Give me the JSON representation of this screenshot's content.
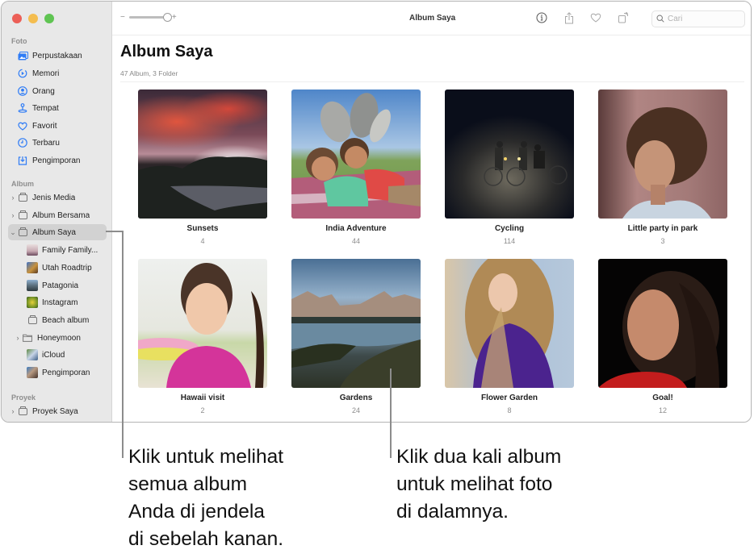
{
  "window": {
    "title": "Album Saya",
    "traffic_lights": [
      "close",
      "minimize",
      "zoom"
    ]
  },
  "toolbar": {
    "zoom_minus": "−",
    "zoom_plus": "+",
    "zoom_level": 1.0,
    "icons": [
      "info-icon",
      "share-icon",
      "heart-icon",
      "rotate-icon"
    ],
    "search_placeholder": "Cari",
    "search_value": ""
  },
  "sidebar": {
    "sections": [
      {
        "label": "Foto",
        "items": [
          {
            "label": "Perpustakaan",
            "icon": "photo-library-icon"
          },
          {
            "label": "Memori",
            "icon": "memories-icon"
          },
          {
            "label": "Orang",
            "icon": "people-icon"
          },
          {
            "label": "Tempat",
            "icon": "places-icon"
          },
          {
            "label": "Favorit",
            "icon": "heart-icon"
          },
          {
            "label": "Terbaru",
            "icon": "clock-icon"
          },
          {
            "label": "Pengimporan",
            "icon": "import-icon"
          }
        ]
      },
      {
        "label": "Album",
        "items": [
          {
            "label": "Jenis Media",
            "icon": "album-stack-icon",
            "expandable": true,
            "expanded": false
          },
          {
            "label": "Album Bersama",
            "icon": "shared-album-icon",
            "expandable": true,
            "expanded": false
          },
          {
            "label": "Album Saya",
            "icon": "album-stack-icon",
            "expandable": true,
            "expanded": true,
            "selected": true
          },
          {
            "label": "Family Family...",
            "icon": "album-thumbnail",
            "indent": 1
          },
          {
            "label": "Utah Roadtrip",
            "icon": "album-thumbnail",
            "indent": 1
          },
          {
            "label": "Patagonia",
            "icon": "album-thumbnail",
            "indent": 1
          },
          {
            "label": "Instagram",
            "icon": "album-thumbnail",
            "indent": 1
          },
          {
            "label": "Beach album",
            "icon": "album-stack-icon",
            "indent": 1
          },
          {
            "label": "Honeymoon",
            "icon": "folder-icon",
            "indent": 1,
            "expandable": true,
            "expanded": false
          },
          {
            "label": "iCloud",
            "icon": "album-thumbnail",
            "indent": 1
          },
          {
            "label": "Pengimporan",
            "icon": "album-thumbnail",
            "indent": 1
          }
        ]
      },
      {
        "label": "Proyek",
        "items": [
          {
            "label": "Proyek Saya",
            "icon": "album-stack-icon",
            "expandable": true,
            "expanded": false
          }
        ]
      }
    ]
  },
  "main": {
    "title": "Album Saya",
    "subtitle": "47 Album, 3 Folder",
    "albums": [
      {
        "name": "Sunsets",
        "count": "4"
      },
      {
        "name": "India Adventure",
        "count": "44"
      },
      {
        "name": "Cycling",
        "count": "114"
      },
      {
        "name": "Little party in park",
        "count": "3"
      },
      {
        "name": "Hawaii visit",
        "count": "2"
      },
      {
        "name": "Gardens",
        "count": "24"
      },
      {
        "name": "Flower Garden",
        "count": "8"
      },
      {
        "name": "Goal!",
        "count": "12"
      }
    ]
  },
  "callouts": {
    "left": [
      "Klik untuk melihat",
      "semua album",
      "Anda di jendela",
      "di sebelah kanan."
    ],
    "right": [
      "Klik dua kali album",
      "untuk melihat foto",
      "di dalamnya."
    ]
  }
}
